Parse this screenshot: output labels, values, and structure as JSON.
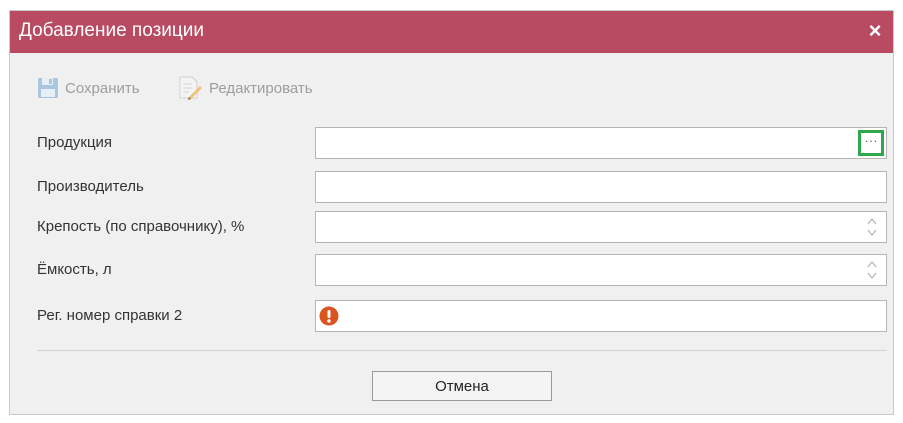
{
  "dialog": {
    "title": "Добавление позиции",
    "close_icon": "×"
  },
  "toolbar": {
    "save_label": "Сохранить",
    "edit_label": "Редактировать"
  },
  "form": {
    "product_label": "Продукция",
    "product_value": "",
    "manufacturer_label": "Производитель",
    "manufacturer_value": "",
    "strength_label": "Крепость (по справочнику), %",
    "strength_value": "",
    "volume_label": "Ёмкость, л",
    "volume_value": "",
    "reg_number_label": "Рег. номер справки 2",
    "reg_number_value": "",
    "browse_button": "···"
  },
  "footer": {
    "cancel_label": "Отмена"
  },
  "colors": {
    "titlebar": "#b84b62",
    "highlight": "#2ea84a",
    "warning": "#d9541e"
  },
  "icons": {
    "save": "floppy-disk-icon",
    "edit": "document-pencil-icon",
    "close": "close-icon",
    "warning": "warning-icon",
    "spinner": "up-down-spinner-icon"
  }
}
